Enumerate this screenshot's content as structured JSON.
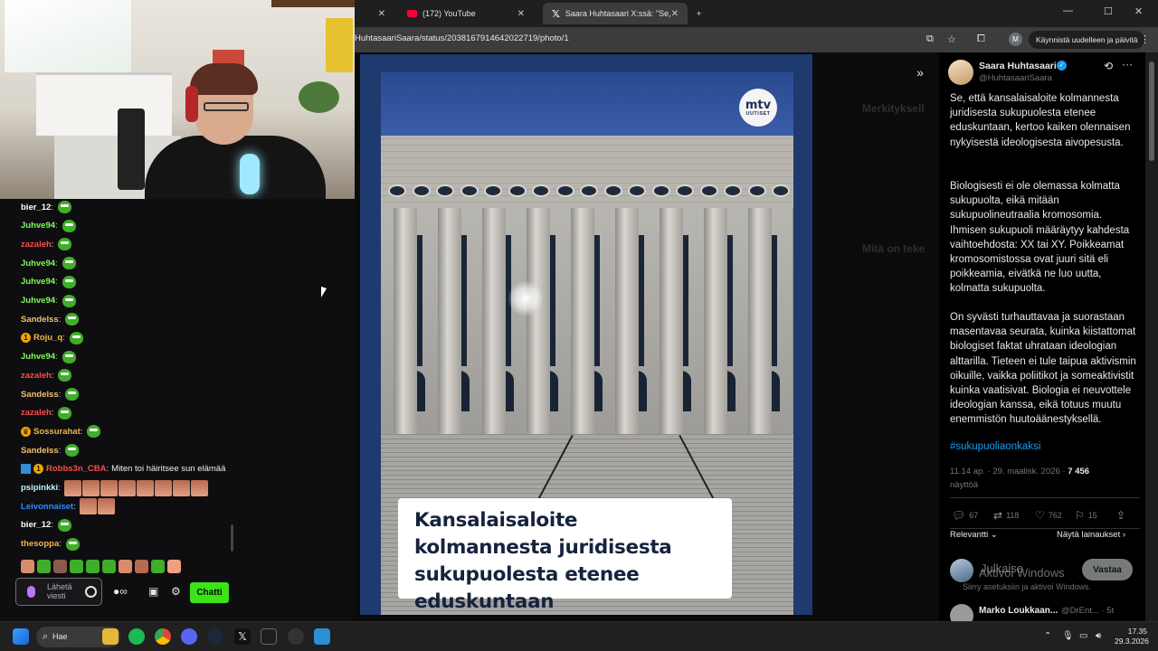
{
  "chat": {
    "messages": [
      {
        "user": "bier_12",
        "color": "#ffffff",
        "msg": "",
        "emotes": "pepe"
      },
      {
        "user": "Juhve94",
        "color": "#7cfc5a",
        "msg": "",
        "emotes": "pepe"
      },
      {
        "user": "zazaleh",
        "color": "#ff4b4b",
        "msg": "",
        "emotes": "pepe"
      },
      {
        "user": "Juhve94",
        "color": "#7cfc5a",
        "msg": "",
        "emotes": "pepe"
      },
      {
        "user": "Juhve94",
        "color": "#7cfc5a",
        "msg": "",
        "emotes": "pepe"
      },
      {
        "user": "Juhve94",
        "color": "#7cfc5a",
        "msg": "",
        "emotes": "pepe"
      },
      {
        "user": "Sandelss",
        "color": "#f0c070",
        "msg": "",
        "emotes": "pepe"
      },
      {
        "user": "Roju_q",
        "color": "#f3b54a",
        "msg": "",
        "emotes": "pepe",
        "badge": "1"
      },
      {
        "user": "Juhve94",
        "color": "#7cfc5a",
        "msg": "",
        "emotes": "pepe"
      },
      {
        "user": "zazaleh",
        "color": "#ff4b4b",
        "msg": "",
        "emotes": "pepe"
      },
      {
        "user": "Sandelss",
        "color": "#f0c070",
        "msg": "",
        "emotes": "pepe"
      },
      {
        "user": "zazaleh",
        "color": "#ff4b4b",
        "msg": "",
        "emotes": "pepe"
      },
      {
        "user": "Sossurahat",
        "color": "#f3b54a",
        "msg": "",
        "emotes": "pepe",
        "badge": "crown"
      },
      {
        "user": "Sandelss",
        "color": "#f0c070",
        "msg": "",
        "emotes": "pepe"
      },
      {
        "user": "Robbs3n_CBA",
        "color": "#ff4b4b",
        "msg": "Miten toi häiritsee sun elämää",
        "emotes": "",
        "badge": "1"
      },
      {
        "user": "psipinkki",
        "color": "#b7f7ff",
        "msg": "",
        "emotes": "faces8"
      },
      {
        "user": "Leivonnaiset",
        "color": "#2e8bff",
        "msg": "",
        "emotes": "faces2"
      },
      {
        "user": "bier_12",
        "color": "#ffffff",
        "msg": "",
        "emotes": "pepe"
      },
      {
        "user": "thesoppa",
        "color": "#f3b54a",
        "msg": "",
        "emotes": "pepe"
      }
    ],
    "input_placeholder": "Lähetä viesti",
    "send_label": "Chatti"
  },
  "browser": {
    "tabs": [
      {
        "label": "",
        "icon": "blank",
        "active": false
      },
      {
        "label": "(172) YouTube",
        "icon": "youtube-icon",
        "active": false
      },
      {
        "label": "Saara Huhtasaari X:ssä: \"Se, että",
        "icon": "x-icon",
        "active": true
      }
    ],
    "new_tab": "+",
    "url": "HuhtasaariSaara/status/2038167914642022719/photo/1",
    "update_button": "Käynnistä uudelleen ja päivitä",
    "profile_initial": "M"
  },
  "photo": {
    "logo_line1": "mtv",
    "logo_line2": "UUTISET",
    "headline": "Kansalaisaloite kolmannesta juridisesta sukupuolesta etenee eduskuntaan"
  },
  "background_page": {
    "relevant_heading": "Merkityksell",
    "whats_happening": "Mitä on teke"
  },
  "tweet": {
    "name": "Saara Huhtasaari",
    "handle": "@HuhtasaariSaara",
    "paragraphs": [
      "Se, että kansalaisaloite kolmannesta juridisesta sukupuolesta etenee eduskuntaan, kertoo kaiken olennaisen nykyisestä ideologisesta aivopesusta.",
      "Biologisesti ei ole olemassa kolmatta sukupuolta, eikä mitään sukupuolineutraalia kromosomia. Ihmisen sukupuoli määräytyy kahdesta vaihtoehdosta: XX tai XY. Poikkeamat kromosomistossa ovat juuri sitä eli poikkeamia, eivätkä ne luo uutta, kolmatta sukupuolta.",
      "On syvästi turhauttavaa ja suorastaan masentavaa seurata, kuinka kiistattomat biologiset faktat uhrataan ideologian alttarilla. Tieteen ei tule taipua aktivismin oikuille, vaikka poliitikot ja someaktivistit kuinka vaatisivat. Biologia ei neuvottele ideologian kanssa, eikä totuus muutu enemmistön huutoäänestyksellä."
    ],
    "hashtag": "#sukupuoliaonkaksi",
    "timestamp": "11.14 ap. · 29. maalisk. 2026 · ",
    "views_count": "7 456",
    "views_label": "näyttöä",
    "replies": "67",
    "reposts": "118",
    "likes": "762",
    "bookmarks": "15",
    "sort_label": "Relevantti",
    "quotes_link": "Näytä lainaukset",
    "reply_placeholder": "Julkaise",
    "reply_button": "Vastaa",
    "next_reply_name": "Marko Loukkaan...",
    "next_reply_handle": "@DrEnt... · 5t"
  },
  "windows": {
    "activate_title": "Aktivoi Windows",
    "activate_sub": "Siirry asetuksiin ja aktivoi Windows.",
    "search_label": "Hae",
    "time": "17.35",
    "date": "29.3.2026"
  }
}
